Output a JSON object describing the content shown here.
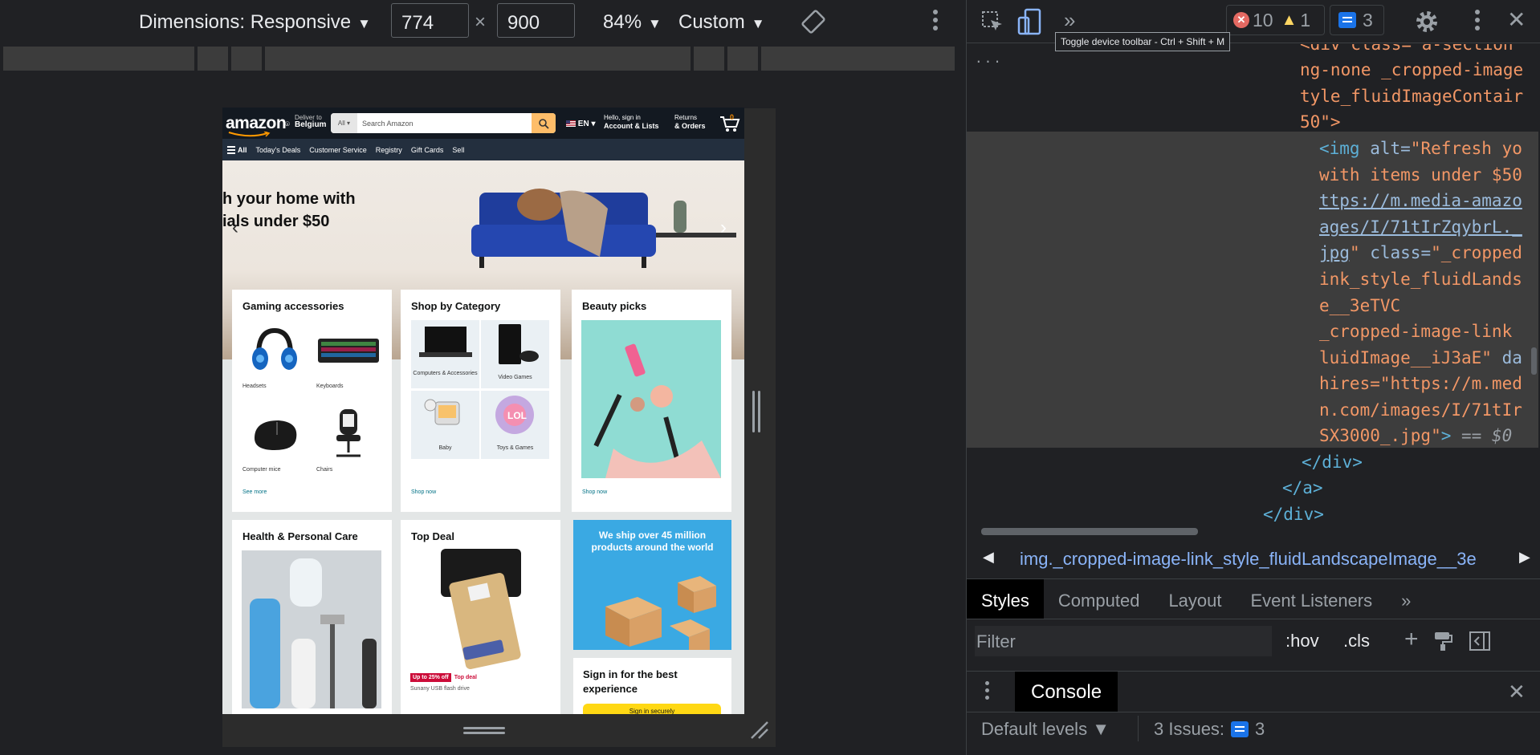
{
  "toolbar": {
    "dimensions_label": "Dimensions: Responsive",
    "width_value": "774",
    "times": "×",
    "height_value": "900",
    "zoom": "84%",
    "throttle": "Custom"
  },
  "site": {
    "logo": "amazon",
    "deliver_line1": "Deliver to",
    "deliver_line2": "Belgium",
    "search_category": "All",
    "search_placeholder": "Search Amazon",
    "lang": "EN",
    "account_line1": "Hello, sign in",
    "account_line2": "Account & Lists",
    "returns_line1": "Returns",
    "returns_line2": "& Orders",
    "cart_count": "0",
    "nav_items": [
      "All",
      "Today's Deals",
      "Customer Service",
      "Registry",
      "Gift Cards",
      "Sell"
    ],
    "hero_line1": "h your home with",
    "hero_line2": "ials under $50",
    "cards": {
      "gaming": {
        "title": "Gaming accessories",
        "items": [
          "Headsets",
          "Keyboards",
          "Computer mice",
          "Chairs"
        ],
        "link": "See more"
      },
      "shop": {
        "title": "Shop by Category",
        "items": [
          "Computers & Accessories",
          "Video Games",
          "Baby",
          "Toys & Games"
        ],
        "link": "Shop now"
      },
      "beauty": {
        "title": "Beauty picks",
        "link": "Shop now"
      },
      "health": {
        "title": "Health & Personal Care"
      },
      "deal": {
        "title": "Top Deal",
        "badge": "Up to 25% off",
        "deal_label": "Top deal",
        "product": "Sunany USB flash drive"
      },
      "ship": {
        "text": "We ship over 45 million products around the world"
      },
      "signin": {
        "title": "Sign in for the best experience",
        "button": "Sign in securely"
      }
    }
  },
  "devtools": {
    "errors": "10",
    "warnings": "1",
    "messages": "3",
    "tooltip": "Toggle device toolbar - Ctrl + Shift + M",
    "code": {
      "l1": "<div class=\"a-section",
      "l2": "ng-none _cropped-image",
      "l3": "tyle_fluidImageContair",
      "l4": "50\">",
      "l5_tag": "<img ",
      "l5_attr": "alt=",
      "l5_str": "\"Refresh yo",
      "l6": "with items under $50",
      "l7": "ttps://m.media-amazo",
      "l8": "ages/I/71tIrZqybrL._",
      "l9_url": "jpg",
      "l9_str": "\"",
      "l9_attr": " class=",
      "l9_str2": "\"_cropped",
      "l10": "ink_style_fluidLands",
      "l11": "e__3eTVC",
      "l12": " _cropped-image-link",
      "l13_str": "luidImage__iJ3aE\"",
      "l13_attr": " da",
      "l14": "hires=\"https://m.med",
      "l15": "n.com/images/I/71tIr",
      "l16_str": "SX3000_.jpg\"",
      "l16_tag": ">",
      "l16_dollar": " == $0",
      "l17": "</div>",
      "l18": "</a>",
      "l19": "</div>",
      "dots": "..."
    },
    "breadcrumb": "img._cropped-image-link_style_fluidLandscapeImage__3e",
    "tabs": [
      "Styles",
      "Computed",
      "Layout",
      "Event Listeners"
    ],
    "more_tabs": "»",
    "filter_placeholder": "Filter",
    "hov": ":hov",
    "cls": ".cls",
    "console_tab": "Console",
    "default_levels": "Default levels",
    "issues_label": "3 Issues:",
    "issues_count": "3"
  }
}
